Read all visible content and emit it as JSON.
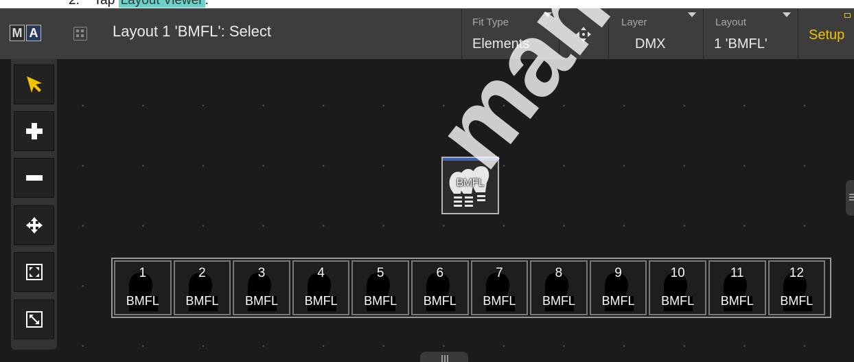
{
  "caption": {
    "number": "2.",
    "text": "Tap ",
    "highlight": "Layout Viewer",
    "suffix": "."
  },
  "window": {
    "logo_m": "M",
    "logo_a": "A",
    "title": "Layout 1 'BMFL': Select"
  },
  "header": {
    "fit_type": {
      "label": "Fit Type",
      "value": "Elements"
    },
    "layer": {
      "label": "Layer",
      "value": "DMX"
    },
    "layout": {
      "label": "Layout",
      "value": "1 'BMFL'"
    },
    "setup": {
      "label": "Setup"
    }
  },
  "tools": [
    {
      "name": "select-arrow-icon"
    },
    {
      "name": "zoom-in-icon"
    },
    {
      "name": "zoom-out-icon"
    },
    {
      "name": "move-icon"
    },
    {
      "name": "fit-all-icon"
    },
    {
      "name": "fit-selection-icon"
    }
  ],
  "group_fixture": {
    "label": "BMFL"
  },
  "fixtures": [
    {
      "id": "1",
      "name": "BMFL"
    },
    {
      "id": "2",
      "name": "BMFL"
    },
    {
      "id": "3",
      "name": "BMFL"
    },
    {
      "id": "4",
      "name": "BMFL"
    },
    {
      "id": "5",
      "name": "BMFL"
    },
    {
      "id": "6",
      "name": "BMFL"
    },
    {
      "id": "7",
      "name": "BMFL"
    },
    {
      "id": "8",
      "name": "BMFL"
    },
    {
      "id": "9",
      "name": "BMFL"
    },
    {
      "id": "10",
      "name": "BMFL"
    },
    {
      "id": "11",
      "name": "BMFL"
    },
    {
      "id": "12",
      "name": "BMFL"
    }
  ],
  "watermark": "manualoza.com",
  "colors": {
    "accent": "#f2c300",
    "highlight": "#6fd0c7",
    "selection_bar": "#3d5fb5"
  }
}
